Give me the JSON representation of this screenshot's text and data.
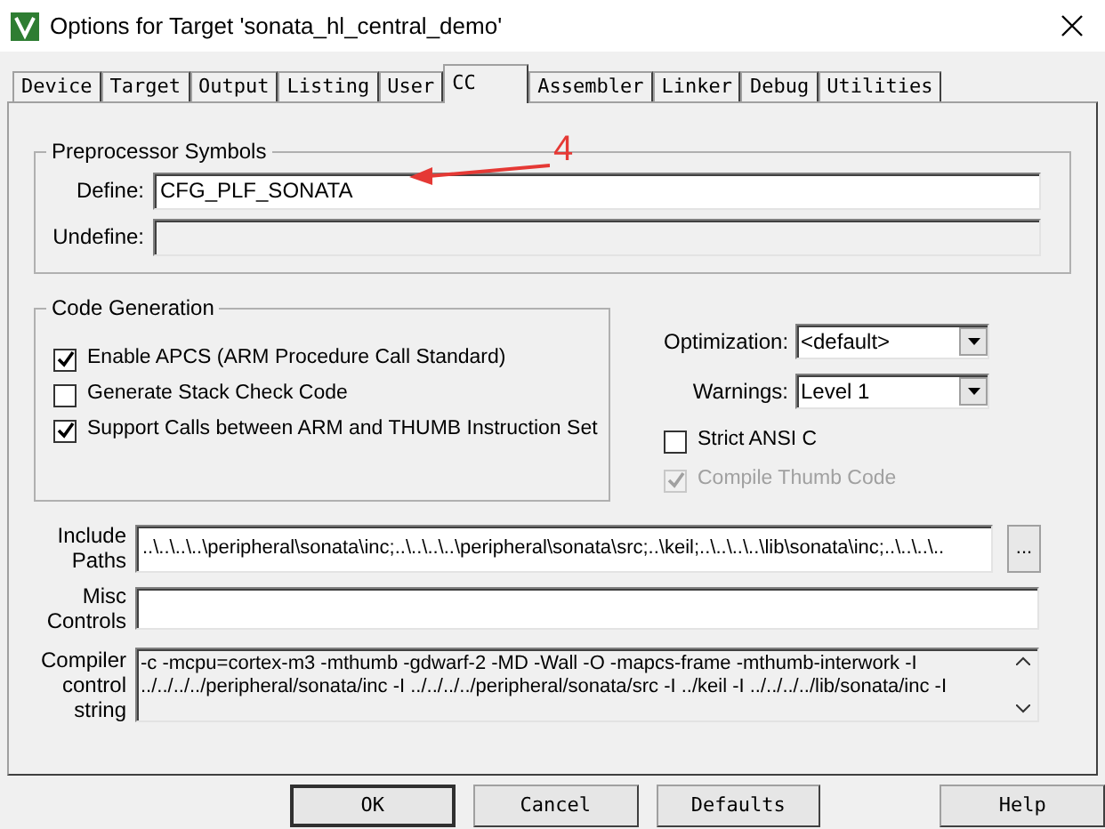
{
  "window": {
    "title": "Options for Target 'sonata_hl_central_demo'"
  },
  "tabs": [
    {
      "label": "Device",
      "selected": false
    },
    {
      "label": "Target",
      "selected": false
    },
    {
      "label": "Output",
      "selected": false
    },
    {
      "label": "Listing",
      "selected": false
    },
    {
      "label": "User",
      "selected": false
    },
    {
      "label": "CC",
      "selected": true
    },
    {
      "label": "Assembler",
      "selected": false
    },
    {
      "label": "Linker",
      "selected": false
    },
    {
      "label": "Debug",
      "selected": false
    },
    {
      "label": "Utilities",
      "selected": false
    }
  ],
  "preprocessor": {
    "title": "Preprocessor Symbols",
    "fields": [
      {
        "label": "Define:",
        "value": "CFG_PLF_SONATA",
        "disabled": false
      },
      {
        "label": "Undefine:",
        "disabled": true
      }
    ]
  },
  "code_generation": {
    "title": "Code Generation",
    "options": [
      {
        "label": "Enable APCS (ARM Procedure Call Standard)",
        "checked": true
      },
      {
        "label": "Generate Stack Check Code",
        "checked": false
      },
      {
        "label": "Support Calls between ARM and THUMB Instruction Set",
        "checked": true
      }
    ]
  },
  "selects": [
    {
      "label": "Optimization:",
      "value": "<default>"
    },
    {
      "label": "Warnings:",
      "value": "Level 1"
    }
  ],
  "right_options": [
    {
      "label": "Strict ANSI C",
      "checked": false,
      "disabled": false
    },
    {
      "label": "Compile Thumb Code",
      "checked": true,
      "disabled": true
    }
  ],
  "include_paths": {
    "label": "Include Paths",
    "value": "..\\..\\..\\..\\peripheral\\sonata\\inc;..\\..\\..\\..\\peripheral\\sonata\\src;..\\keil;..\\..\\..\\..\\lib\\sonata\\inc;..\\..\\..\\..",
    "browse": "..."
  },
  "misc_controls": {
    "label": "Misc Controls"
  },
  "compiler_control_string": {
    "label": "Compiler control string",
    "lines": [
      "-c -mcpu=cortex-m3 -mthumb -gdwarf-2 -MD -Wall -O -mapcs-frame -mthumb-interwork -I",
      "../../../../peripheral/sonata/inc -I ../../../../peripheral/sonata/src -I ../keil -I ../../../../lib/sonata/inc -I"
    ]
  },
  "annotation": {
    "label": "4"
  },
  "buttons": [
    {
      "label": "OK",
      "default": true
    },
    {
      "label": "Cancel",
      "default": false
    },
    {
      "label": "Defaults",
      "default": false
    },
    {
      "label": "Help",
      "default": false
    }
  ]
}
